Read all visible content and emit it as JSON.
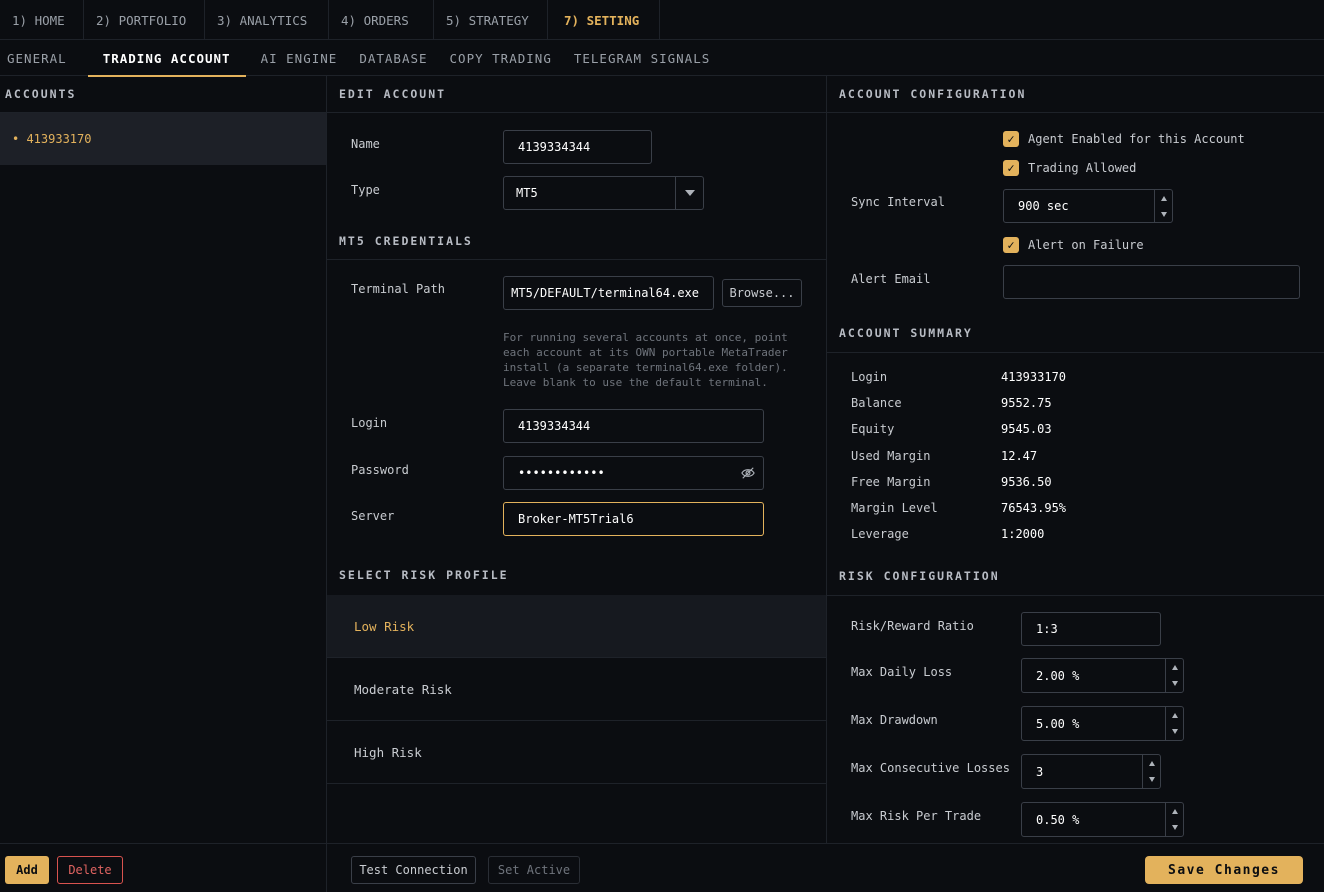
{
  "top_tabs": [
    {
      "label": "1) HOME"
    },
    {
      "label": "2) PORTFOLIO"
    },
    {
      "label": "3) ANALYTICS"
    },
    {
      "label": "4) ORDERS"
    },
    {
      "label": "5) STRATEGY"
    },
    {
      "label": "7) SETTING"
    }
  ],
  "sub_tabs": [
    {
      "label": "GENERAL"
    },
    {
      "label": "TRADING ACCOUNT"
    },
    {
      "label": "AI ENGINE"
    },
    {
      "label": "DATABASE"
    },
    {
      "label": "COPY TRADING"
    },
    {
      "label": "TELEGRAM SIGNALS"
    }
  ],
  "accounts": {
    "title": "ACCOUNTS",
    "items": [
      {
        "label": "• 413933170"
      }
    ],
    "add_label": "Add",
    "delete_label": "Delete"
  },
  "edit": {
    "title": "EDIT ACCOUNT",
    "name_label": "Name",
    "name_value": "4139334344",
    "type_label": "Type",
    "type_value": "MT5",
    "credentials_title": "MT5 CREDENTIALS",
    "terminal_label": "Terminal Path",
    "terminal_value": "MT5/DEFAULT/terminal64.exe",
    "browse_label": "Browse...",
    "help_lines": [
      "For running several accounts at once, point",
      "each account at its OWN portable MetaTrader",
      "install (a separate terminal64.exe folder).",
      "Leave blank to use the default terminal."
    ],
    "login_label": "Login",
    "login_value": "4139334344",
    "password_label": "Password",
    "password_value": "••••••••••••",
    "server_label": "Server",
    "server_value": "Broker-MT5Trial6",
    "risk_title": "SELECT RISK PROFILE",
    "risk_profiles": [
      {
        "label": "Low Risk"
      },
      {
        "label": "Moderate Risk"
      },
      {
        "label": "High Risk"
      }
    ],
    "test_label": "Test Connection",
    "set_active_label": "Set Active"
  },
  "config": {
    "title": "ACCOUNT CONFIGURATION",
    "agent_enabled_label": "Agent Enabled for this Account",
    "trading_allowed_label": "Trading Allowed",
    "sync_label": "Sync Interval",
    "sync_value": "900 sec",
    "alert_failure_label": "Alert on Failure",
    "alert_email_label": "Alert Email",
    "alert_email_value": ""
  },
  "summary": {
    "title": "ACCOUNT SUMMARY",
    "rows": [
      {
        "label": "Login",
        "value": "413933170"
      },
      {
        "label": "Balance",
        "value": "9552.75"
      },
      {
        "label": "Equity",
        "value": "9545.03"
      },
      {
        "label": "Used Margin",
        "value": "12.47"
      },
      {
        "label": "Free Margin",
        "value": "9536.50"
      },
      {
        "label": "Margin Level",
        "value": "76543.95%"
      },
      {
        "label": "Leverage",
        "value": "1:2000"
      }
    ]
  },
  "risk_config": {
    "title": "RISK CONFIGURATION",
    "rr_label": "Risk/Reward Ratio",
    "rr_value": "1:3",
    "daily_loss_label": "Max Daily Loss",
    "daily_loss_value": "2.00 %",
    "drawdown_label": "Max Drawdown",
    "drawdown_value": "5.00 %",
    "consec_label": "Max Consecutive Losses",
    "consec_value": "3",
    "per_trade_label": "Max Risk Per Trade",
    "per_trade_value": "0.50 %"
  },
  "save_label": "Save Changes",
  "colors": {
    "accent": "#e3b25c",
    "danger": "#d9534f",
    "background": "#0b0d11"
  }
}
